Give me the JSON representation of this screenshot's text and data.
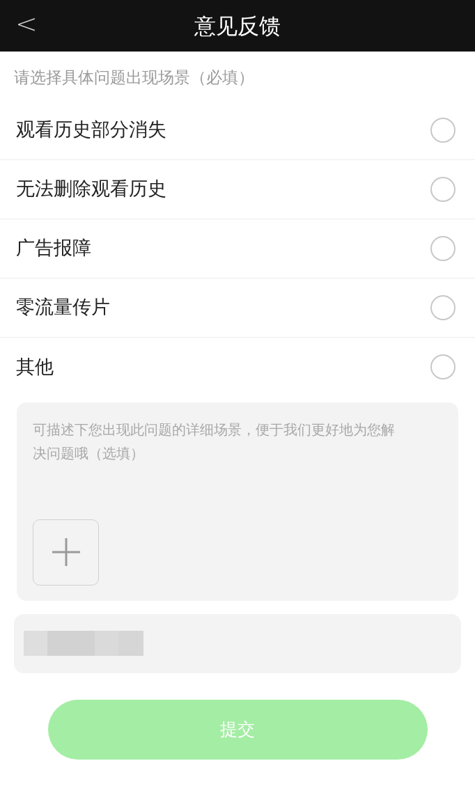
{
  "header": {
    "back": "<",
    "title": "意见反馈"
  },
  "prompt": "请选择具体问题出现场景（必填）",
  "options": [
    {
      "label": "观看历史部分消失",
      "selected": false
    },
    {
      "label": "无法删除观看历史",
      "selected": false
    },
    {
      "label": "广告报障",
      "selected": false
    },
    {
      "label": "零流量传片",
      "selected": false
    },
    {
      "label": "其他",
      "selected": false
    }
  ],
  "description": {
    "placeholder": "可描述下您出现此问题的详细场景，便于我们更好地为您解决问题哦（选填）"
  },
  "contact": {
    "redacted": true
  },
  "submit": {
    "label": "提交",
    "disabled": true
  }
}
